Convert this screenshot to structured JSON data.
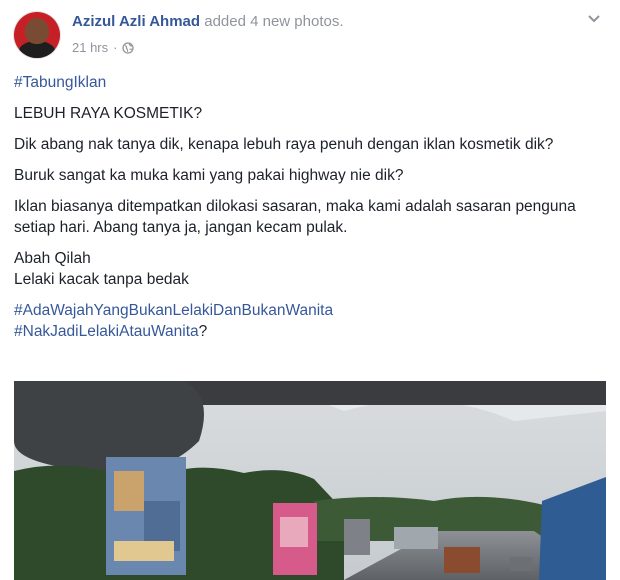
{
  "post": {
    "author": "Azizul Azli Ahmad",
    "action": " added 4 new photos.",
    "time": "21 hrs",
    "separator": "·",
    "options_glyph": "⌄",
    "hashtag_top": "#TabungIklan",
    "title": "LEBUH RAYA KOSMETIK?",
    "para1": "Dik abang nak tanya dik, kenapa lebuh raya penuh dengan iklan kosmetik dik?",
    "para2": "Buruk sangat ka muka kami yang pakai highway nie dik?",
    "para3": "Iklan biasanya ditempatkan dilokasi sasaran, maka kami adalah sasaran penguna setiap hari. Abang tanya ja, jangan kecam pulak.",
    "signature_line1": "Abah Qilah",
    "signature_line2": "Lelaki kacak tanpa bedak",
    "hashtag_bottom1": "#AdaWajahYangBukanLelakiDanBukanWanita",
    "hashtag_bottom2": "#NakJadiLelakiAtauWanita",
    "hashtag_bottom2_suffix": "?"
  },
  "icons": {
    "privacy": "globe-icon",
    "options": "chevron-down-icon"
  },
  "colors": {
    "link": "#365899",
    "text": "#1d2129",
    "muted": "#90949c",
    "avatar_bg": "#c62026"
  }
}
